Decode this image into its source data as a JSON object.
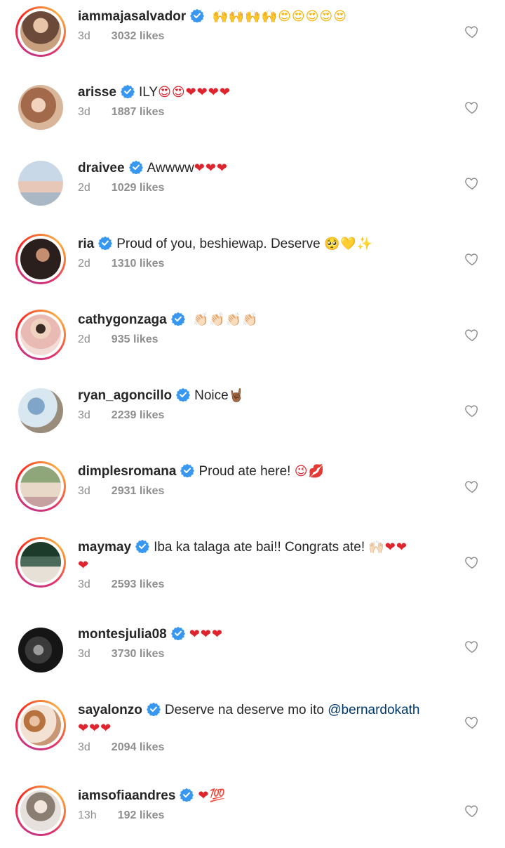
{
  "comments": [
    {
      "username": "iammajasalvador",
      "text": "",
      "emojis": "🙌🙌🙌🙌😍😍😍😍😍",
      "time": "3d",
      "likes": "3032 likes",
      "avatar_colors": [
        "#6b4a3a",
        "#c9a07e"
      ]
    },
    {
      "username": "arisse",
      "text": "ILY",
      "emojis": "😍😍❤❤❤❤",
      "time": "3d",
      "likes": "1887 likes",
      "avatar_colors": [
        "#d9b59a",
        "#a26a4b"
      ]
    },
    {
      "username": "draivee",
      "text": "Awwww",
      "emojis": "❤❤❤",
      "time": "2d",
      "likes": "1029 likes",
      "avatar_colors": [
        "#c9d8e6",
        "#e6c7b8"
      ]
    },
    {
      "username": "ria",
      "text": "Proud of you, beshiewap. Deserve",
      "emojis": "🥺💛✨",
      "time": "2d",
      "likes": "1310 likes",
      "avatar_colors": [
        "#2a1f1c",
        "#8a5c45"
      ]
    },
    {
      "username": "cathygonzaga",
      "text": "",
      "emojis": "👏🏻👏🏻👏🏻👏🏻",
      "time": "2d",
      "likes": "935 likes",
      "avatar_colors": [
        "#f3dcd6",
        "#e9b9b3"
      ]
    },
    {
      "username": "ryan_agoncillo",
      "text": "Noice",
      "emojis": "🤘🏾",
      "time": "3d",
      "likes": "2239 likes",
      "avatar_colors": [
        "#d8e7f0",
        "#9a8c7a"
      ]
    },
    {
      "username": "dimplesromana",
      "text": "Proud ate here!",
      "emojis": "😉💋",
      "time": "3d",
      "likes": "2931 likes",
      "avatar_colors": [
        "#b7c9a8",
        "#e8d8c8"
      ]
    },
    {
      "username": "maymay",
      "text": "Iba ka talaga ate bai!! Congrats ate!",
      "emojis": "🙌🏻❤❤",
      "wrap": "❤",
      "time": "3d",
      "likes": "2593 likes",
      "avatar_colors": [
        "#1d3b2a",
        "#4c6a5a"
      ]
    },
    {
      "username": "montesjulia08",
      "text": "",
      "emojis": "❤❤❤",
      "time": "3d",
      "likes": "3730 likes",
      "avatar_colors": [
        "#1f1f1f",
        "#6f6f6f"
      ]
    },
    {
      "username": "sayalonzo",
      "text": "Deserve na deserve mo ito",
      "mention": "@bernardokath",
      "wrap": "❤❤❤",
      "time": "3d",
      "likes": "2094 likes",
      "avatar_colors": [
        "#f3e2d4",
        "#b7733f"
      ]
    },
    {
      "username": "iamsofiaandres",
      "text": "",
      "emojis": "❤💯",
      "time": "13h",
      "likes": "192 likes",
      "avatar_colors": [
        "#e6e1dc",
        "#8a7d72"
      ]
    }
  ],
  "icons": {
    "verified": "verified-badge-icon",
    "like": "heart-outline-icon"
  },
  "colors": {
    "verified_blue": "#3897f0",
    "meta_gray": "#8e8e8e",
    "heart_red": "#e0242e"
  }
}
